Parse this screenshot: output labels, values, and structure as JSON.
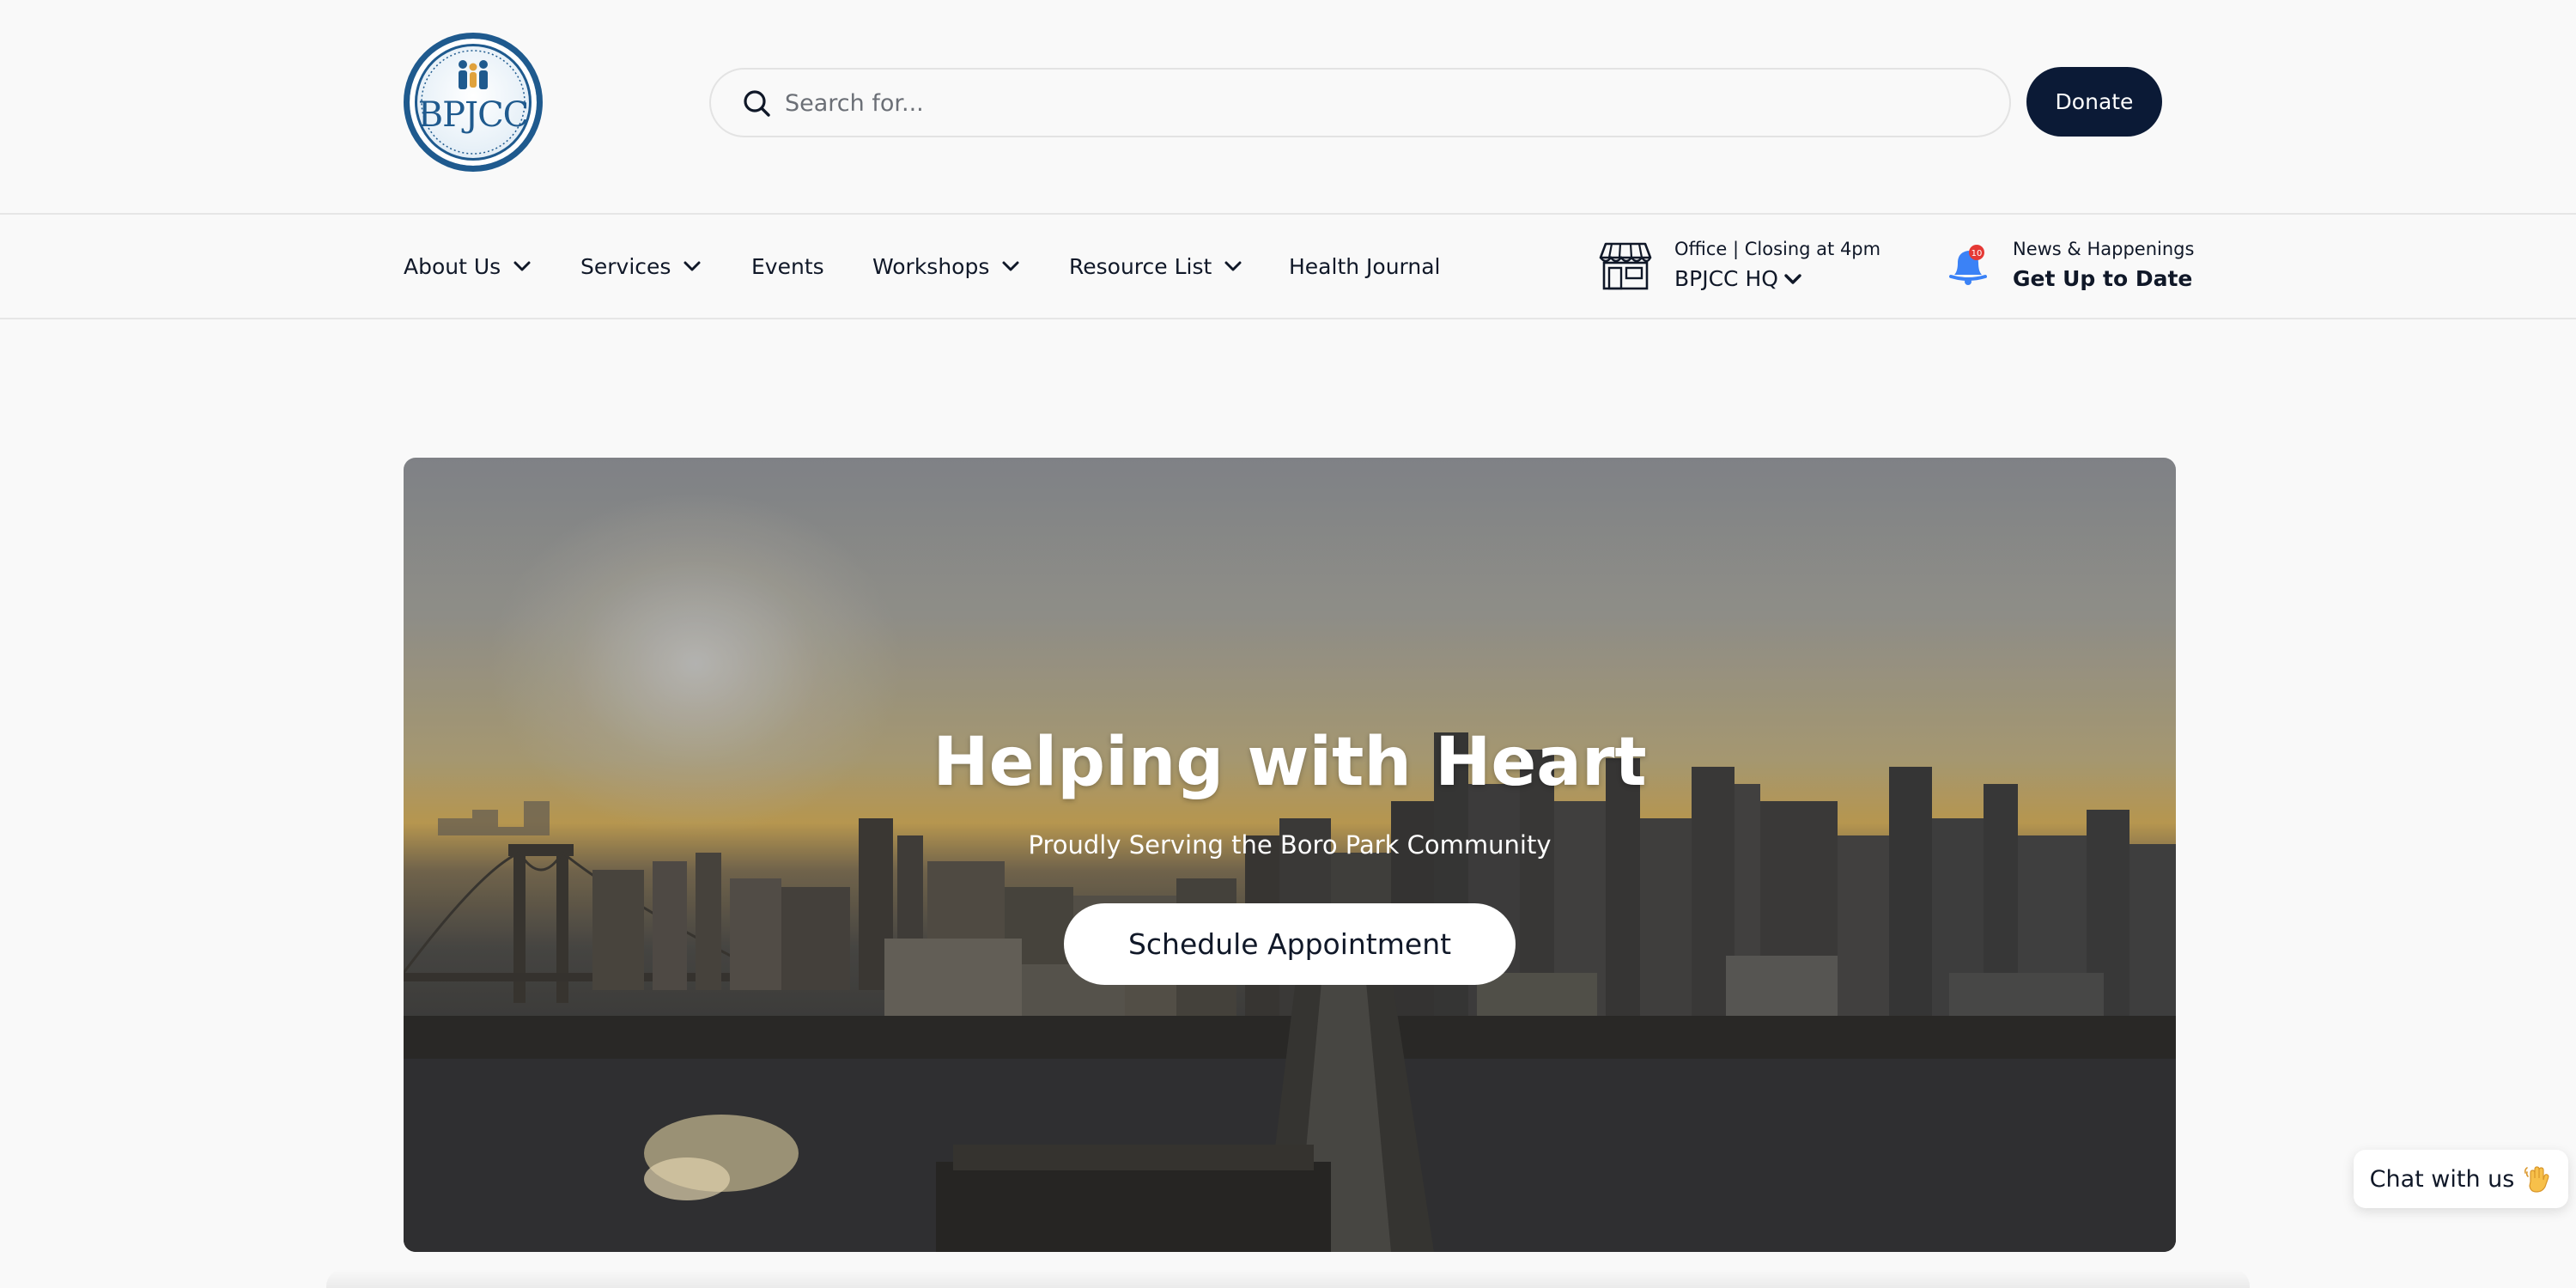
{
  "header": {
    "logo": {
      "text": "BPJCC",
      "ring_text": "BORO PARK JEWISH COMMUNITY COUNCIL"
    },
    "search": {
      "placeholder": "Search for...",
      "value": ""
    },
    "donate_label": "Donate"
  },
  "nav": {
    "items": [
      {
        "label": "About Us",
        "has_dropdown": true
      },
      {
        "label": "Services",
        "has_dropdown": true
      },
      {
        "label": "Events",
        "has_dropdown": false
      },
      {
        "label": "Workshops",
        "has_dropdown": true
      },
      {
        "label": "Resource List",
        "has_dropdown": true
      },
      {
        "label": "Health Journal",
        "has_dropdown": false
      }
    ],
    "office": {
      "line1": "Office  |  Closing at 4pm",
      "location": "BPJCC HQ",
      "icon": "storefront-icon"
    },
    "news": {
      "line1": "News & Happenings",
      "line2": "Get Up to Date",
      "badge_count": "10",
      "icon": "bell-icon"
    }
  },
  "hero": {
    "title": "Helping with Heart",
    "subtitle": "Proudly Serving the Boro Park Community",
    "cta_label": "Schedule Appointment"
  },
  "chat": {
    "label": "Chat with us",
    "icon": "waving-hand-icon"
  },
  "colors": {
    "brand_navy": "#0b1a36",
    "logo_blue": "#1f5a8e",
    "logo_gold": "#e0a23c",
    "badge_red": "#e53935",
    "bell_blue": "#3b82f6",
    "page_bg": "#f9f9f9"
  }
}
